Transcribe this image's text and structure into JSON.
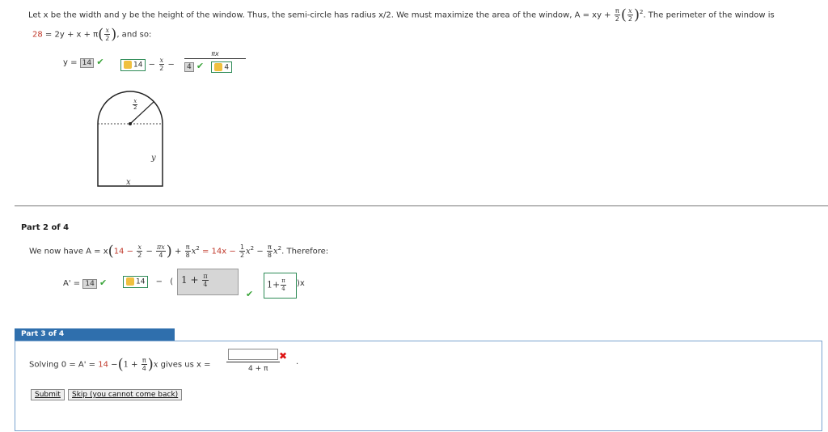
{
  "part1": {
    "intro_text": "Let x be the width and y be the height of the window. Thus, the semi-circle has radius x/2. We must maximize the area of the window, A = xy +",
    "intro_end": ". The perimeter of the window is",
    "perim_lhs": "28",
    "perim_eq": "= 2y + x + π",
    "and_so": ", and so:",
    "y_label": "y =",
    "y_box": "14",
    "y_key": "14",
    "minus_x_over": "−",
    "pi_x": "πx",
    "four_box": "4",
    "four_key": "4",
    "diagram": {
      "radius_label": "x/2",
      "height_label": "y",
      "width_label": "x"
    }
  },
  "part2": {
    "label": "Part 2 of 4",
    "we_now_have": "We now have A = x",
    "inner": "14 −",
    "plus": "+",
    "equals_rhs": "= 14x −",
    "minus_pi": "−",
    "therefore": ". Therefore:",
    "aprime_label": "A' =",
    "aprime_box": "14",
    "aprime_key": "14",
    "minus": "−",
    "gray_expr": "1 + π/4",
    "key_expr": "1+ π/4",
    "x_suffix": ")x"
  },
  "part3": {
    "label": "Part 3 of 4",
    "solving": "Solving 0 = A' =",
    "fourteen": "14",
    "minus_paren": "−",
    "gives_us": "gives us x =",
    "denominator": "4 + π",
    "submit": "Submit",
    "skip": "Skip (you cannot come back)"
  }
}
